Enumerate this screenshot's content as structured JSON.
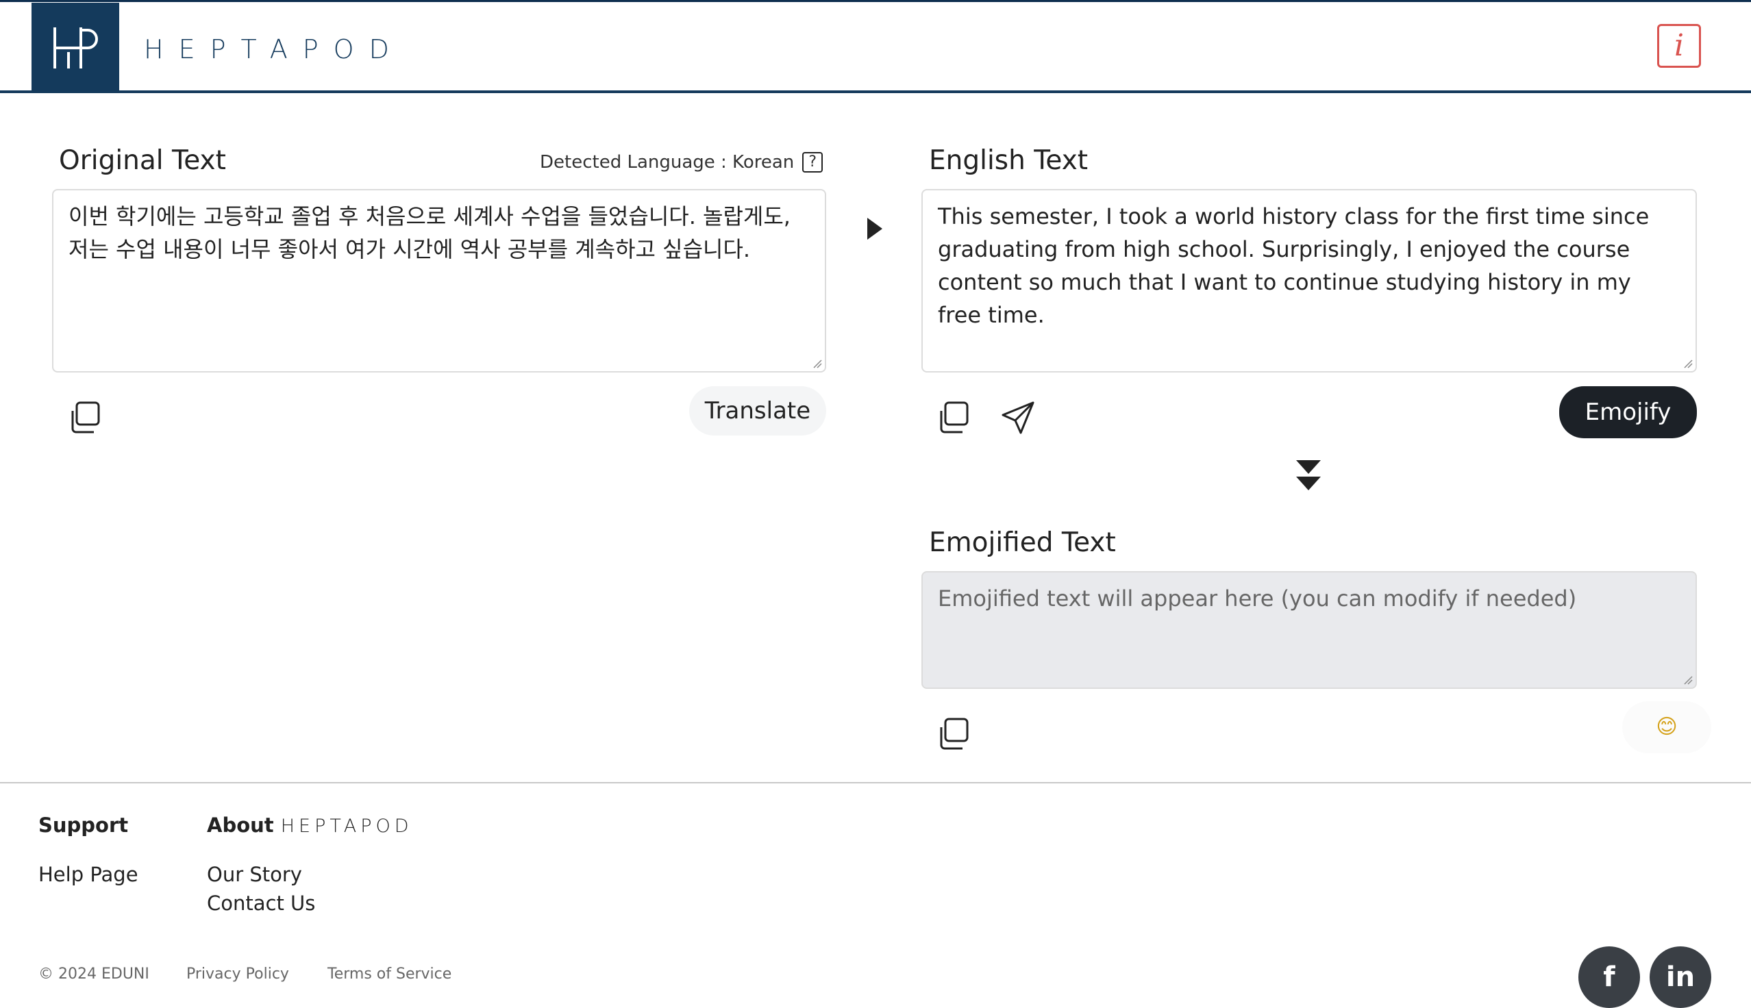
{
  "header": {
    "brand": "HEPTAPOD",
    "info_label": "i"
  },
  "original": {
    "title": "Original Text",
    "detected_label": "Detected Language : Korean",
    "help_label": "?",
    "text": "이번 학기에는 고등학교 졸업 후 처음으로 세계사 수업을 들었습니다. 놀랍게도, 저는 수업 내용이 너무 좋아서 여가 시간에 역사 공부를 계속하고 싶습니다.",
    "translate_label": "Translate"
  },
  "english": {
    "title": "English Text",
    "text": "This semester, I took a world history class for the first time since graduating from high school. Surprisingly, I enjoyed the course content so much that I want to continue studying history in my free time.",
    "emojify_label": "Emojify"
  },
  "emojified": {
    "title": "Emojified Text",
    "placeholder": "Emojified text will appear here (you can modify if needed)",
    "emoji_button": "😊"
  },
  "footer": {
    "support_heading": "Support",
    "help_page": "Help Page",
    "about_heading": "About",
    "about_brand": "HEPTAPOD",
    "our_story": "Our Story",
    "contact_us": "Contact Us",
    "copyright": "© 2024 EDUNI",
    "privacy": "Privacy Policy",
    "terms": "Terms of Service",
    "facebook": "f",
    "linkedin": "in"
  },
  "colors": {
    "brand_navy": "#143a5c",
    "info_red": "#d9534f",
    "dark_button": "#1c2127"
  }
}
